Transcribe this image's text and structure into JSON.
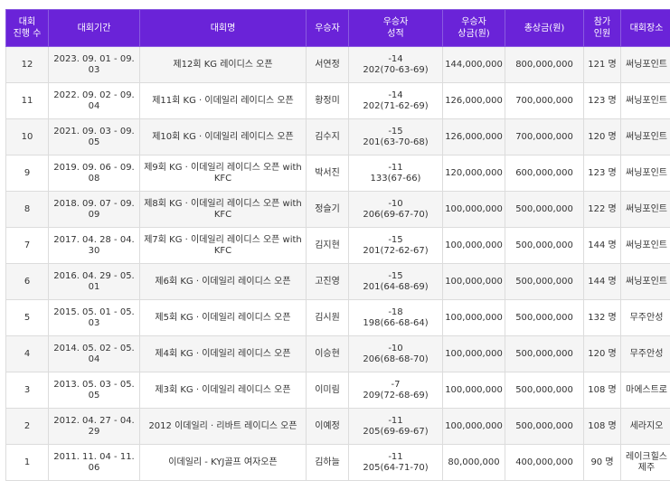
{
  "headers": {
    "round": [
      "대회",
      "진행 수"
    ],
    "period": "대회기간",
    "name": "대회명",
    "winner": "우승자",
    "score": [
      "우승자",
      "성적"
    ],
    "prize": [
      "우승자",
      "상금(원)"
    ],
    "total": "총상금(원)",
    "players": [
      "참가",
      "인원"
    ],
    "venue": "대회장소"
  },
  "rows": [
    {
      "round": "12",
      "period": "2023. 09. 01 - 09. 03",
      "name": "제12회 KG 레이디스 오픈",
      "winner": "서연정",
      "score_top": "-14",
      "score_bot": "202(70-63-69)",
      "prize": "144,000,000",
      "total": "800,000,000",
      "players": "121 명",
      "venue": "써닝포인트"
    },
    {
      "round": "11",
      "period": "2022. 09. 02 - 09. 04",
      "name": "제11회 KG · 이데일리 레이디스 오픈",
      "winner": "황정미",
      "score_top": "-14",
      "score_bot": "202(71-62-69)",
      "prize": "126,000,000",
      "total": "700,000,000",
      "players": "123 명",
      "venue": "써닝포인트"
    },
    {
      "round": "10",
      "period": "2021. 09. 03 - 09. 05",
      "name": "제10회 KG · 이데일리 레이디스 오픈",
      "winner": "김수지",
      "score_top": "-15",
      "score_bot": "201(63-70-68)",
      "prize": "126,000,000",
      "total": "700,000,000",
      "players": "120 명",
      "venue": "써닝포인트"
    },
    {
      "round": "9",
      "period": "2019. 09. 06 - 09. 08",
      "name": "제9회 KG · 이데일리 레이디스 오픈 with KFC",
      "winner": "박서진",
      "score_top": "-11",
      "score_bot": "133(67-66)",
      "prize": "120,000,000",
      "total": "600,000,000",
      "players": "123 명",
      "venue": "써닝포인트"
    },
    {
      "round": "8",
      "period": "2018. 09. 07 - 09. 09",
      "name": "제8회 KG · 이데일리 레이디스 오픈 with KFC",
      "winner": "정슬기",
      "score_top": "-10",
      "score_bot": "206(69-67-70)",
      "prize": "100,000,000",
      "total": "500,000,000",
      "players": "122 명",
      "venue": "써닝포인트"
    },
    {
      "round": "7",
      "period": "2017. 04. 28 - 04. 30",
      "name": "제7회 KG · 이데일리 레이디스 오픈 with KFC",
      "winner": "김지현",
      "score_top": "-15",
      "score_bot": "201(72-62-67)",
      "prize": "100,000,000",
      "total": "500,000,000",
      "players": "144 명",
      "venue": "써닝포인트"
    },
    {
      "round": "6",
      "period": "2016. 04. 29 - 05. 01",
      "name": "제6회 KG · 이데일리 레이디스 오픈",
      "winner": "고진영",
      "score_top": "-15",
      "score_bot": "201(64-68-69)",
      "prize": "100,000,000",
      "total": "500,000,000",
      "players": "144 명",
      "venue": "써닝포인트"
    },
    {
      "round": "5",
      "period": "2015. 05. 01 - 05. 03",
      "name": "제5회 KG · 이데일리 레이디스 오픈",
      "winner": "김시원",
      "score_top": "-18",
      "score_bot": "198(66-68-64)",
      "prize": "100,000,000",
      "total": "500,000,000",
      "players": "132 명",
      "venue": "무주안성"
    },
    {
      "round": "4",
      "period": "2014. 05. 02 - 05. 04",
      "name": "제4회 KG · 이데일리 레이디스 오픈",
      "winner": "이승현",
      "score_top": "-10",
      "score_bot": "206(68-68-70)",
      "prize": "100,000,000",
      "total": "500,000,000",
      "players": "120 명",
      "venue": "무주안성"
    },
    {
      "round": "3",
      "period": "2013. 05. 03 - 05. 05",
      "name": "제3회 KG · 이데일리 레이디스 오픈",
      "winner": "이미림",
      "score_top": "-7",
      "score_bot": "209(72-68-69)",
      "prize": "100,000,000",
      "total": "500,000,000",
      "players": "108 명",
      "venue": "마에스트로"
    },
    {
      "round": "2",
      "period": "2012. 04. 27 - 04. 29",
      "name": "2012 이데일리 · 리바트 레이디스 오픈",
      "winner": "이예정",
      "score_top": "-11",
      "score_bot": "205(69-69-67)",
      "prize": "100,000,000",
      "total": "500,000,000",
      "players": "108 명",
      "venue": "세라지오"
    },
    {
      "round": "1",
      "period": "2011. 11. 04 - 11. 06",
      "name": "이데일리 - KYJ골프 여자오픈",
      "winner": "김하늘",
      "score_top": "-11",
      "score_bot": "205(64-71-70)",
      "prize": "80,000,000",
      "total": "400,000,000",
      "players": "90 명",
      "venue": "레이크힐스 제주"
    }
  ]
}
